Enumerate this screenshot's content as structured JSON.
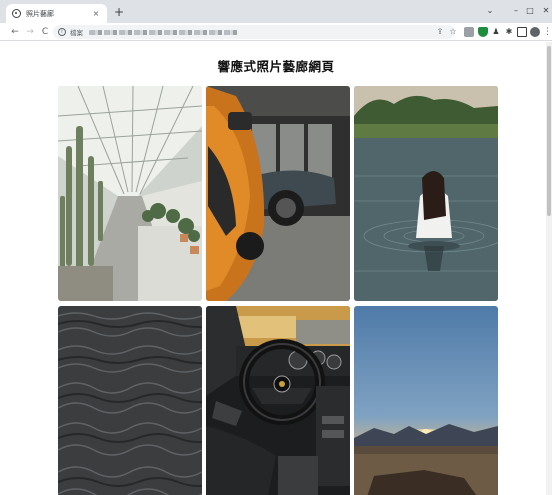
{
  "browser": {
    "tab_title": "照片藝廊",
    "tab_close": "×",
    "new_tab": "+",
    "url_scheme": "檔案",
    "window_controls": {
      "chevron": "⌄",
      "minimize": "–",
      "maximize": "□",
      "close": "✕"
    }
  },
  "toolbar": {
    "back": "←",
    "forward": "→",
    "reload": "C",
    "info": "i",
    "share": "⇪",
    "star": "☆",
    "menu": "⋮"
  },
  "page": {
    "title": "響應式照片藝廊網頁"
  },
  "gallery": {
    "photos": [
      {
        "subject": "greenhouse-with-cacti"
      },
      {
        "subject": "orange-sports-car"
      },
      {
        "subject": "woman-in-lake"
      },
      {
        "subject": "dark-ocean-water"
      },
      {
        "subject": "car-interior-steering-wheel"
      },
      {
        "subject": "sunset-over-mountains"
      }
    ]
  },
  "colors": {
    "tabstrip": "#dee1e6",
    "accent_extension": "#1e8e3e"
  }
}
